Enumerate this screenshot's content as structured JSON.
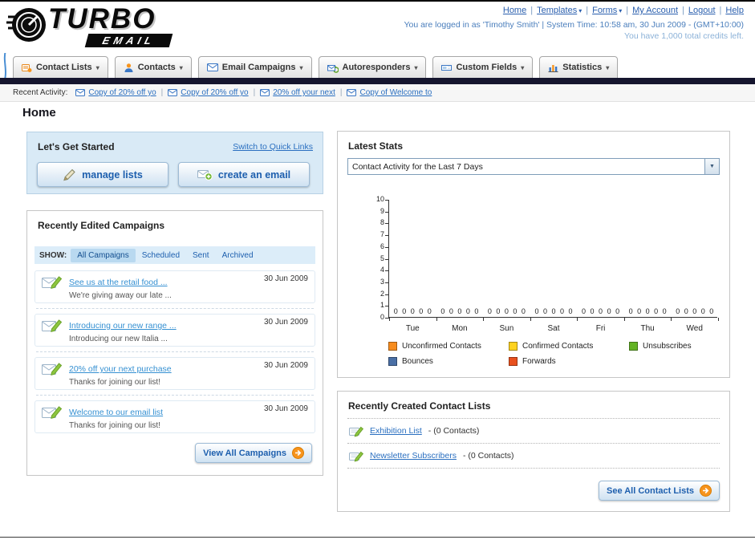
{
  "colors": {
    "link_blue": "#2a6fc0",
    "accent_orange": "#f7941d",
    "navy_bar": "#15152e",
    "panel_blue_bg": "#d9eaf6"
  },
  "header": {
    "logo": {
      "line1": "TURBO",
      "line2": "EMAIL"
    },
    "nav": [
      {
        "label": "Home",
        "dropdown": false
      },
      {
        "label": "Templates",
        "dropdown": true
      },
      {
        "label": "Forms",
        "dropdown": true
      },
      {
        "label": "My Account",
        "dropdown": false
      },
      {
        "label": "Logout",
        "dropdown": false
      },
      {
        "label": "Help",
        "dropdown": false
      }
    ],
    "session_line": "You are logged in as 'Timothy Smith' | System Time: 10:58 am, 30 Jun 2009 - (GMT+10:00)",
    "credits_line": "You have 1,000 total credits left."
  },
  "tabs": [
    {
      "label": "Contact Lists"
    },
    {
      "label": "Contacts"
    },
    {
      "label": "Email Campaigns"
    },
    {
      "label": "Autoresponders"
    },
    {
      "label": "Custom Fields"
    },
    {
      "label": "Statistics"
    }
  ],
  "recent_activity": {
    "label": "Recent Activity:",
    "items": [
      {
        "text": "Copy of 20% off yo"
      },
      {
        "text": "Copy of 20% off yo"
      },
      {
        "text": "20% off your next"
      },
      {
        "text": "Copy of Welcome to"
      }
    ]
  },
  "page": {
    "title": "Home"
  },
  "get_started": {
    "title": "Let's Get Started",
    "switch_link": "Switch to Quick Links",
    "manage_lists_label": "manage lists",
    "create_email_label": "create an email"
  },
  "campaigns": {
    "title": "Recently Edited Campaigns",
    "show_label": "SHOW:",
    "filters": [
      {
        "label": "All Campaigns",
        "active": true
      },
      {
        "label": "Scheduled",
        "active": false
      },
      {
        "label": "Sent",
        "active": false
      },
      {
        "label": "Archived",
        "active": false
      }
    ],
    "items": [
      {
        "title": "See us at the retail food ...",
        "subtitle": "We're giving away our late ...",
        "date": "30 Jun 2009"
      },
      {
        "title": "Introducing our new range ...",
        "subtitle": "Introducing our new Italia ...",
        "date": "30 Jun 2009"
      },
      {
        "title": "20% off your next purchase",
        "subtitle": "Thanks for joining our list!",
        "date": "30 Jun 2009"
      },
      {
        "title": "Welcome to our email list",
        "subtitle": "Thanks for joining our list!",
        "date": "30 Jun 2009"
      }
    ],
    "view_all_label": "View All Campaigns"
  },
  "stats": {
    "title": "Latest Stats",
    "dropdown_value": "Contact Activity for the Last 7 Days"
  },
  "chart_data": {
    "type": "bar",
    "title": "Contact Activity for the Last 7 Days",
    "categories": [
      "Tue",
      "Mon",
      "Sun",
      "Sat",
      "Fri",
      "Thu",
      "Wed"
    ],
    "series": [
      {
        "name": "Unconfirmed Contacts",
        "color": "#f78c1e",
        "values": [
          0,
          0,
          0,
          0,
          0,
          0,
          0
        ]
      },
      {
        "name": "Confirmed Contacts",
        "color": "#ffd21e",
        "values": [
          0,
          0,
          0,
          0,
          0,
          0,
          0
        ]
      },
      {
        "name": "Unsubscribes",
        "color": "#63b324",
        "values": [
          0,
          0,
          0,
          0,
          0,
          0,
          0
        ]
      },
      {
        "name": "Bounces",
        "color": "#4a6fa5",
        "values": [
          0,
          0,
          0,
          0,
          0,
          0,
          0
        ]
      },
      {
        "name": "Forwards",
        "color": "#e8501e",
        "values": [
          0,
          0,
          0,
          0,
          0,
          0,
          0
        ]
      }
    ],
    "ylim": [
      0,
      10
    ],
    "yticks": [
      0,
      1,
      2,
      3,
      4,
      5,
      6,
      7,
      8,
      9,
      10
    ],
    "grid": false,
    "legend_position": "bottom",
    "value_labels_shown": true
  },
  "contact_lists": {
    "title": "Recently Created Contact Lists",
    "items": [
      {
        "name": "Exhibition List",
        "detail": "- (0 Contacts)"
      },
      {
        "name": "Newsletter Subscribers",
        "detail": "- (0 Contacts)"
      }
    ],
    "see_all_label": "See All Contact Lists"
  }
}
